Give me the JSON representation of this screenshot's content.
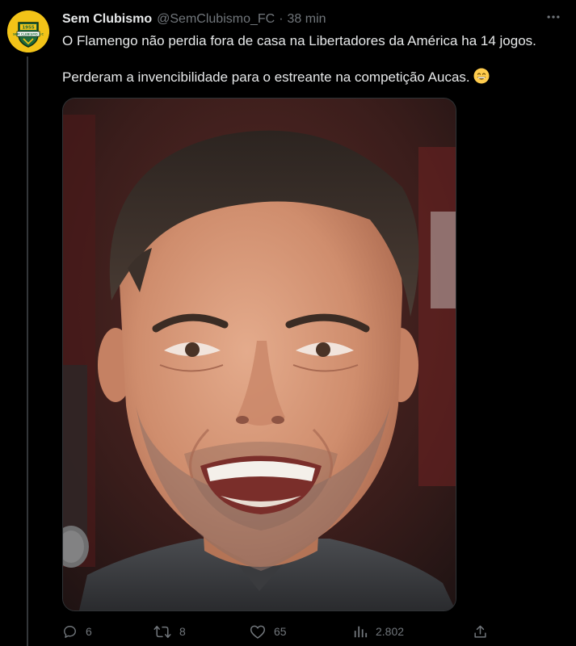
{
  "tweet": {
    "author": {
      "display_name": "Sem Clubismo",
      "handle": "@SemClubismo_FC",
      "separator": "·",
      "time": "38 min",
      "avatar_text": "SEM CLUBISMO F.C",
      "avatar_year": "1955"
    },
    "text": {
      "line1": "O Flamengo não perdia fora de casa na Libertadores da América ha 14 jogos.",
      "line2": "Perderam a invencibilidade para o estreante na competição Aucas."
    },
    "media": {
      "alt": "Foto de um homem sorrindo"
    },
    "actions": {
      "replies": "6",
      "retweets": "8",
      "likes": "65",
      "views": "2.802"
    }
  },
  "colors": {
    "background": "#000000",
    "text_primary": "#e7e9ea",
    "text_secondary": "#71767b",
    "avatar_bg": "#f2c318",
    "avatar_badge": "#1f6b3a"
  },
  "icons": {
    "more": "more-icon",
    "reply": "reply-icon",
    "retweet": "retweet-icon",
    "like": "like-icon",
    "views": "views-icon",
    "share": "share-icon",
    "emoji": "grinning-emoji-icon"
  }
}
